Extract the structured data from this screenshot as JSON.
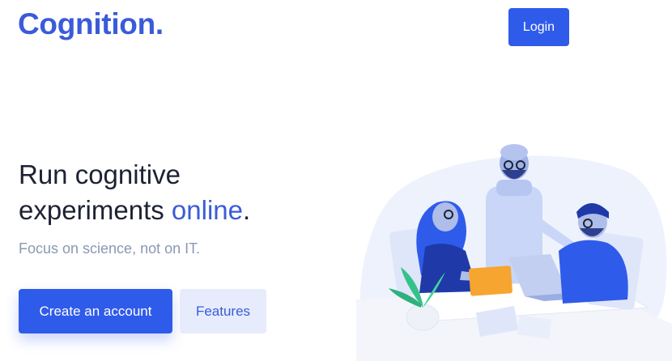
{
  "header": {
    "logo_text": "Cognition.",
    "login_label": "Login"
  },
  "hero": {
    "headline_line1": "Run cognitive",
    "headline_line2_prefix": "experiments ",
    "headline_accent": "online",
    "headline_suffix": ".",
    "subheadline": "Focus on science, not on IT.",
    "primary_cta": "Create an account",
    "secondary_cta": "Features"
  },
  "illustration": {
    "description_icon": "team-working-illustration"
  },
  "colors": {
    "brand": "#3a5bd9",
    "primary_button": "#2f5bea",
    "secondary_button_bg": "#e6ecfb",
    "heading_text": "#1d2233",
    "muted_text": "#8a98b3"
  }
}
